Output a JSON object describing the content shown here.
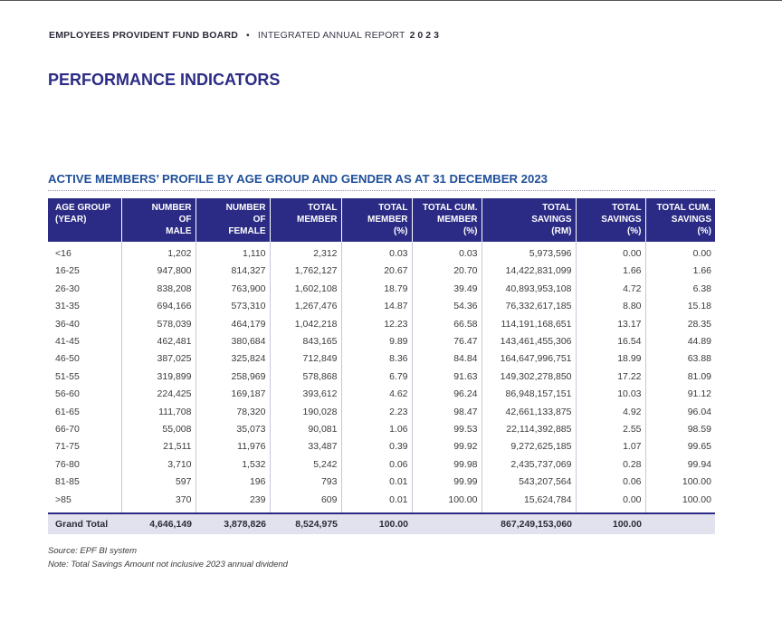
{
  "header": {
    "org": "EMPLOYEES PROVIDENT FUND BOARD",
    "bullet": "•",
    "report": "INTEGRATED ANNUAL REPORT",
    "year": "2023"
  },
  "page_title": "PERFORMANCE INDICATORS",
  "section_title": "ACTIVE MEMBERS’ PROFILE BY AGE GROUP AND GENDER AS AT 31 DECEMBER 2023",
  "table": {
    "columns": [
      [
        "AGE GROUP",
        "(YEAR)"
      ],
      [
        "NUMBER",
        "OF",
        "MALE"
      ],
      [
        "NUMBER",
        "OF",
        "FEMALE"
      ],
      [
        "TOTAL",
        "MEMBER"
      ],
      [
        "TOTAL",
        "MEMBER",
        "(%)"
      ],
      [
        "TOTAL CUM.",
        "MEMBER",
        "(%)"
      ],
      [
        "TOTAL",
        "SAVINGS",
        "(RM)"
      ],
      [
        "TOTAL",
        "SAVINGS",
        "(%)"
      ],
      [
        "TOTAL CUM.",
        "SAVINGS",
        "(%)"
      ]
    ],
    "rows": [
      [
        "<16",
        "1,202",
        "1,110",
        "2,312",
        "0.03",
        "0.03",
        "5,973,596",
        "0.00",
        "0.00"
      ],
      [
        "16-25",
        "947,800",
        "814,327",
        "1,762,127",
        "20.67",
        "20.70",
        "14,422,831,099",
        "1.66",
        "1.66"
      ],
      [
        "26-30",
        "838,208",
        "763,900",
        "1,602,108",
        "18.79",
        "39.49",
        "40,893,953,108",
        "4.72",
        "6.38"
      ],
      [
        "31-35",
        "694,166",
        "573,310",
        "1,267,476",
        "14.87",
        "54.36",
        "76,332,617,185",
        "8.80",
        "15.18"
      ],
      [
        "36-40",
        "578,039",
        "464,179",
        "1,042,218",
        "12.23",
        "66.58",
        "114,191,168,651",
        "13.17",
        "28.35"
      ],
      [
        "41-45",
        "462,481",
        "380,684",
        "843,165",
        "9.89",
        "76.47",
        "143,461,455,306",
        "16.54",
        "44.89"
      ],
      [
        "46-50",
        "387,025",
        "325,824",
        "712,849",
        "8.36",
        "84.84",
        "164,647,996,751",
        "18.99",
        "63.88"
      ],
      [
        "51-55",
        "319,899",
        "258,969",
        "578,868",
        "6.79",
        "91.63",
        "149,302,278,850",
        "17.22",
        "81.09"
      ],
      [
        "56-60",
        "224,425",
        "169,187",
        "393,612",
        "4.62",
        "96.24",
        "86,948,157,151",
        "10.03",
        "91.12"
      ],
      [
        "61-65",
        "111,708",
        "78,320",
        "190,028",
        "2.23",
        "98.47",
        "42,661,133,875",
        "4.92",
        "96.04"
      ],
      [
        "66-70",
        "55,008",
        "35,073",
        "90,081",
        "1.06",
        "99.53",
        "22,114,392,885",
        "2.55",
        "98.59"
      ],
      [
        "71-75",
        "21,511",
        "11,976",
        "33,487",
        "0.39",
        "99.92",
        "9,272,625,185",
        "1.07",
        "99.65"
      ],
      [
        "76-80",
        "3,710",
        "1,532",
        "5,242",
        "0.06",
        "99.98",
        "2,435,737,069",
        "0.28",
        "99.94"
      ],
      [
        "81-85",
        "597",
        "196",
        "793",
        "0.01",
        "99.99",
        "543,207,564",
        "0.06",
        "100.00"
      ],
      [
        ">85",
        "370",
        "239",
        "609",
        "0.01",
        "100.00",
        "15,624,784",
        "0.00",
        "100.00"
      ]
    ],
    "total": [
      "Grand Total",
      "4,646,149",
      "3,878,826",
      "8,524,975",
      "100.00",
      "",
      "867,249,153,060",
      "100.00",
      ""
    ]
  },
  "source": "Source: EPF BI system",
  "note": "Note: Total Savings Amount not inclusive 2023 annual dividend"
}
